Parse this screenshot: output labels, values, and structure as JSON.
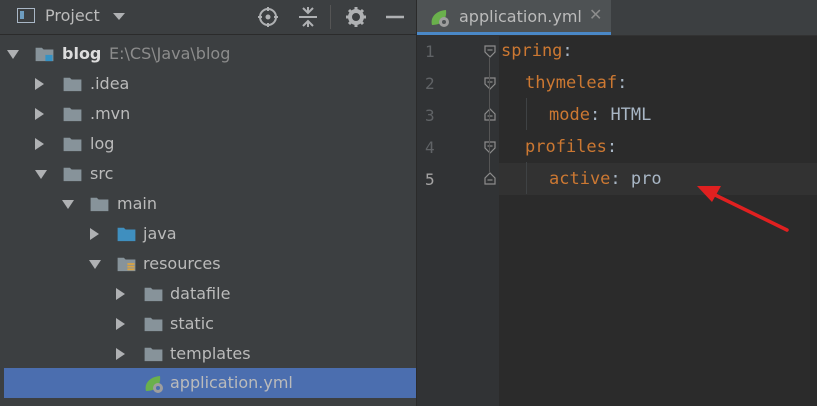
{
  "project_panel": {
    "title": "Project",
    "header_icons": [
      "locate-icon",
      "collapse-all-icon",
      "settings-icon",
      "minimize-icon"
    ],
    "tree": [
      {
        "label": "blog",
        "path": "E:\\CS\\Java\\blog",
        "bold": true,
        "expanded": true
      },
      {
        "label": ".idea",
        "expanded": false
      },
      {
        "label": ".mvn",
        "expanded": false
      },
      {
        "label": "log",
        "expanded": false
      },
      {
        "label": "src",
        "expanded": true
      },
      {
        "label": "main",
        "expanded": true
      },
      {
        "label": "java",
        "expanded": false
      },
      {
        "label": "resources",
        "expanded": true
      },
      {
        "label": "datafile",
        "expanded": false
      },
      {
        "label": "static",
        "expanded": false
      },
      {
        "label": "templates",
        "expanded": false
      },
      {
        "label": "application.yml",
        "selected": true
      }
    ]
  },
  "editor": {
    "tab_label": "application.yml",
    "tab_close": "✕",
    "line_numbers": [
      "1",
      "2",
      "3",
      "4",
      "5"
    ],
    "current_line": 5,
    "lines": [
      {
        "key": "spring",
        "colon": ":",
        "value": ""
      },
      {
        "key": "thymeleaf",
        "colon": ":",
        "value": ""
      },
      {
        "key": "mode",
        "colon": ":",
        "value": " HTML"
      },
      {
        "key": "profiles",
        "colon": ":",
        "value": ""
      },
      {
        "key": "active",
        "colon": ":",
        "value": " pro"
      }
    ]
  },
  "colors": {
    "panel_bg": "#3c3f41",
    "editor_bg": "#2b2b2b",
    "selection": "#4b6eaf",
    "yaml_key": "#cc7832",
    "yaml_value": "#a9b7c6",
    "annotation_arrow": "#e02020"
  }
}
